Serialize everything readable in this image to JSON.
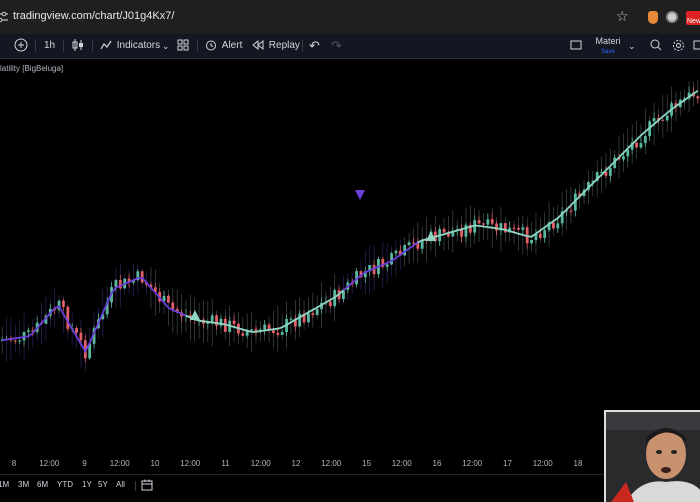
{
  "browser": {
    "url": "tradingview.com/chart/J01g4Kx7/",
    "badge_text": "New"
  },
  "toolbar": {
    "interval": "1h",
    "indicators_label": "Indicators",
    "alert_label": "Alert",
    "replay_label": "Replay",
    "layout_name": "Materi",
    "layout_status": "Save"
  },
  "chart": {
    "indicator_label": "latility [BigBeluga]"
  },
  "chart_data": {
    "type": "candlestick",
    "title": "",
    "x_ticks": [
      "8",
      "12:00",
      "9",
      "12:00",
      "10",
      "12:00",
      "11",
      "12:00",
      "12",
      "12:00",
      "15",
      "12:00",
      "16",
      "12:00",
      "17",
      "12:00",
      "18"
    ],
    "close_path": [
      0.71,
      0.7,
      0.62,
      0.74,
      0.58,
      0.55,
      0.63,
      0.66,
      0.67,
      0.69,
      0.68,
      0.64,
      0.6,
      0.54,
      0.51,
      0.46,
      0.44,
      0.42,
      0.43,
      0.45,
      0.4,
      0.33,
      0.26,
      0.19,
      0.13,
      0.08
    ],
    "signals": [
      {
        "type": "buy",
        "x": "10 12:00"
      },
      {
        "type": "sell",
        "x": "14 12:00"
      },
      {
        "type": "buy",
        "x": "16"
      }
    ],
    "colors": {
      "up": "#5bb8a0",
      "down": "#e0606a",
      "trend_bull": "#8fd6c4",
      "trend_bear": "#6b3fd8",
      "band": "#7a8a94"
    }
  },
  "range_buttons": [
    "1M",
    "3M",
    "6M",
    "YTD",
    "1Y",
    "5Y",
    "All"
  ]
}
